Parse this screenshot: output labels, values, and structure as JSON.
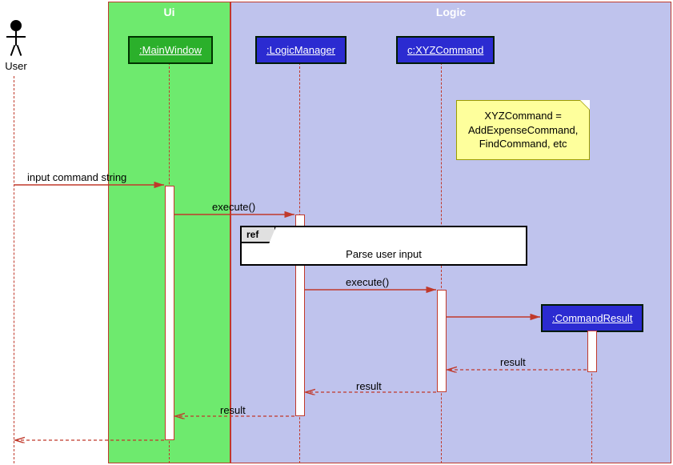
{
  "chart_data": {
    "type": "sequence_diagram",
    "actors": [
      "User"
    ],
    "regions": [
      {
        "name": "Ui",
        "lifelines": [
          ":MainWindow"
        ]
      },
      {
        "name": "Logic",
        "lifelines": [
          ":LogicManager",
          "c:XYZCommand",
          ":CommandResult"
        ]
      }
    ],
    "note": "XYZCommand = AddExpenseCommand, FindCommand, etc",
    "messages": [
      {
        "from": "User",
        "to": ":MainWindow",
        "label": "input command string",
        "type": "sync"
      },
      {
        "from": ":MainWindow",
        "to": ":LogicManager",
        "label": "execute()",
        "type": "sync"
      },
      {
        "ref": "Parse user input"
      },
      {
        "from": ":LogicManager",
        "to": "c:XYZCommand",
        "label": "execute()",
        "type": "sync"
      },
      {
        "from": "c:XYZCommand",
        "to": ":CommandResult",
        "label": "",
        "type": "create"
      },
      {
        "from": ":CommandResult",
        "to": "c:XYZCommand",
        "label": "result",
        "type": "return"
      },
      {
        "from": "c:XYZCommand",
        "to": ":LogicManager",
        "label": "result",
        "type": "return"
      },
      {
        "from": ":LogicManager",
        "to": ":MainWindow",
        "label": "result",
        "type": "return"
      },
      {
        "from": ":MainWindow",
        "to": "User",
        "label": "",
        "type": "return"
      }
    ]
  },
  "regions": {
    "ui": "Ui",
    "logic": "Logic"
  },
  "actor": {
    "user": "User"
  },
  "lifelines": {
    "mainwindow": ":MainWindow",
    "logicmanager": ":LogicManager",
    "xyzcommand": "c:XYZCommand",
    "commandresult": ":CommandResult"
  },
  "note": {
    "line1": "XYZCommand =",
    "line2": "AddExpenseCommand,",
    "line3": "FindCommand, etc"
  },
  "messages": {
    "input": "input command string",
    "execute1": "execute()",
    "ref_tab": "ref",
    "ref_label": "Parse user input",
    "execute2": "execute()",
    "result1": "result",
    "result2": "result",
    "result3": "result"
  }
}
